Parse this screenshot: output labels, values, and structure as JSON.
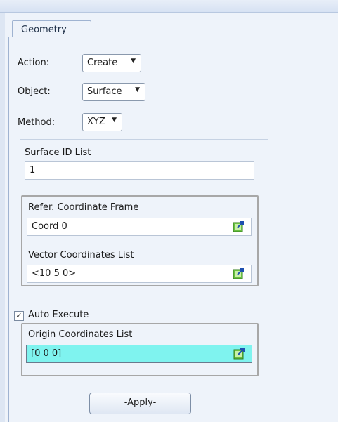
{
  "tab": {
    "label": "Geometry"
  },
  "action": {
    "label": "Action:",
    "value": "Create"
  },
  "object": {
    "label": "Object:",
    "value": "Surface"
  },
  "method": {
    "label": "Method:",
    "value": "XYZ"
  },
  "surface_id": {
    "label": "Surface ID List",
    "value": "1"
  },
  "ref_frame": {
    "label": "Refer. Coordinate Frame",
    "value": "Coord 0"
  },
  "vector": {
    "label": "Vector Coordinates List",
    "value": "<10 5 0>"
  },
  "auto_execute": {
    "label": "Auto Execute",
    "checked": true,
    "mark": "✓"
  },
  "origin": {
    "label": "Origin Coordinates List",
    "value": "[0 0 0]"
  },
  "apply_label": "-Apply-",
  "icons": {
    "dropdown": "triangle-down",
    "select_tool": "select-menu-icon"
  },
  "colors": {
    "highlight_field": "#7ff3ef",
    "panel_bg": "#eef3fa"
  }
}
